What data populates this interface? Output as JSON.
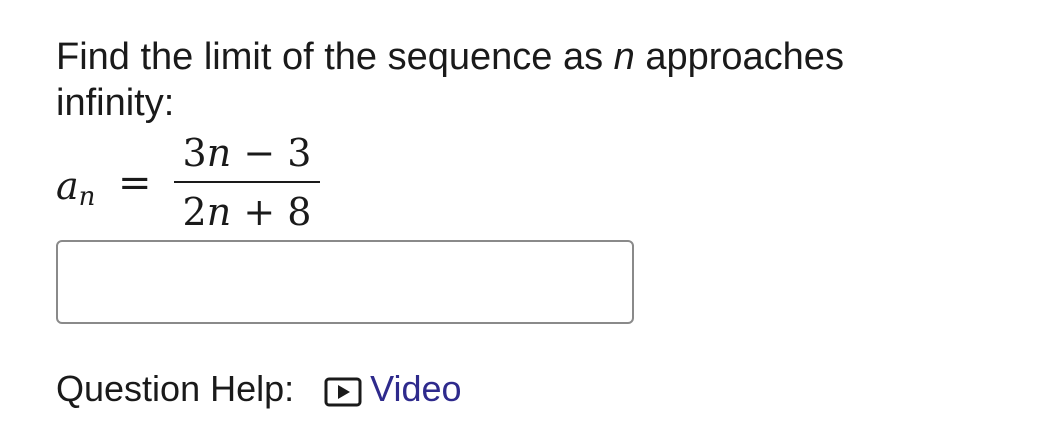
{
  "question": {
    "text_before": "Find the limit of the sequence as ",
    "variable": "n",
    "text_after": " approaches infinity:"
  },
  "formula": {
    "lhs_base": "a",
    "lhs_subscript": "n",
    "equals": "=",
    "numerator": {
      "coef": "3",
      "var": "n",
      "op": "−",
      "const": "3"
    },
    "denominator": {
      "coef": "2",
      "var": "n",
      "op": "+",
      "const": "8"
    }
  },
  "answer": {
    "value": "",
    "placeholder": ""
  },
  "help": {
    "label": "Question Help:",
    "video_label": "Video",
    "video_icon": "play-icon",
    "link_color": "#2e2a8c"
  }
}
